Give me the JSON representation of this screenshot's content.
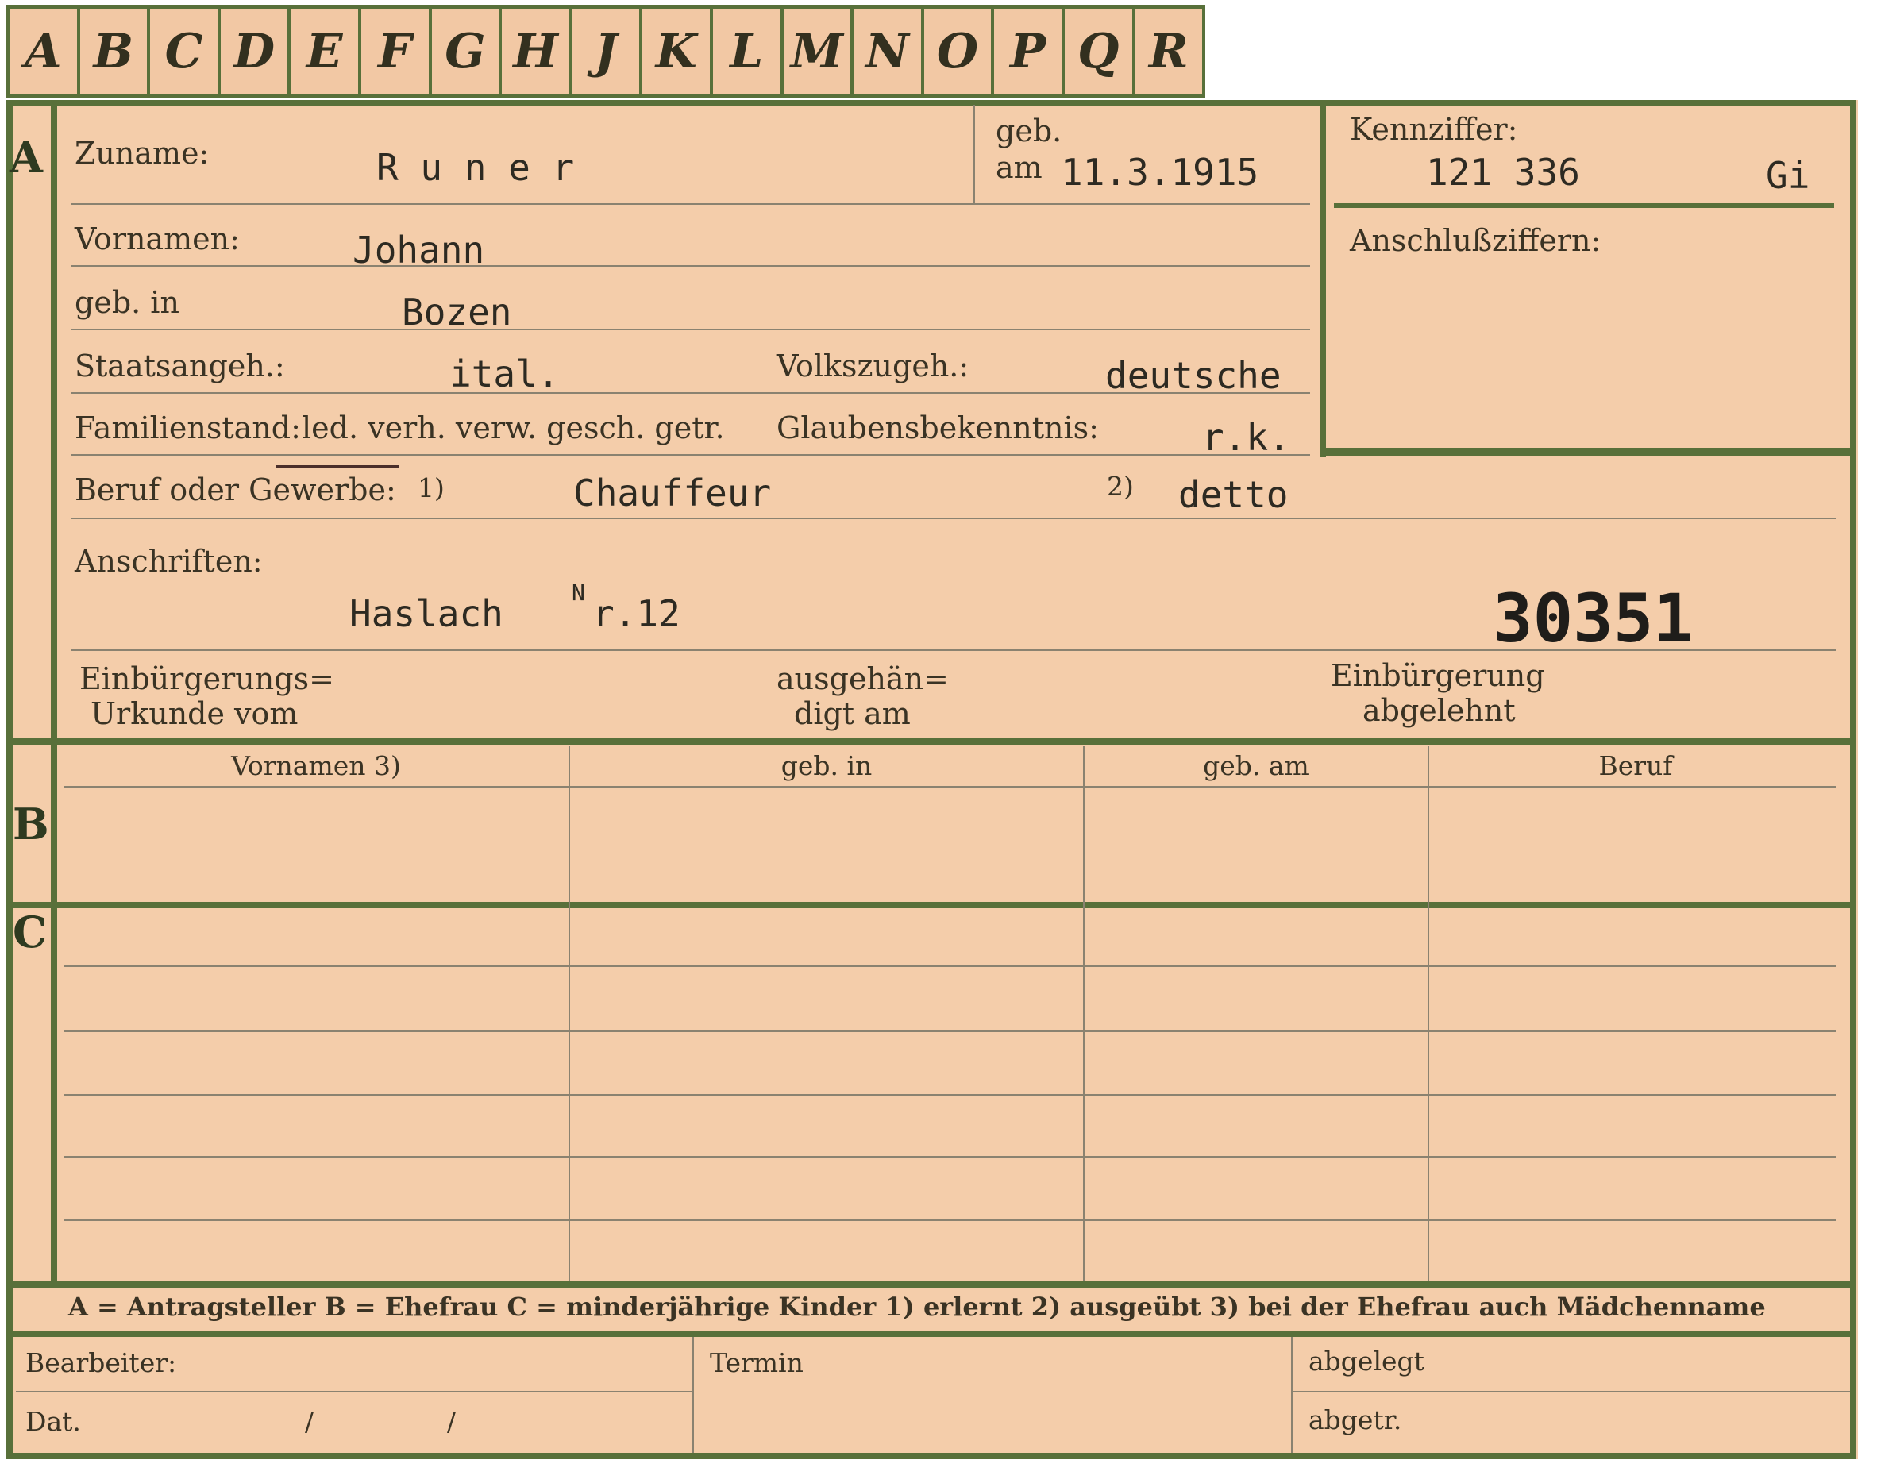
{
  "tabs": [
    "A",
    "B",
    "C",
    "D",
    "E",
    "F",
    "G",
    "H",
    "J",
    "K",
    "L",
    "M",
    "N",
    "O",
    "P",
    "Q",
    "R"
  ],
  "rows": {
    "a": "A",
    "b": "B",
    "c": "C"
  },
  "section_a": {
    "surname_label": "Zuname:",
    "surname": "R u n e r",
    "born_label_1": "geb.",
    "born_label_2": "am",
    "born_date": "11.3.1915",
    "id_label": "Kennziffer:",
    "id_number": "121 336",
    "id_suffix": "Gi",
    "linked_label": "Anschlußziffern:",
    "firstnames_label": "Vornamen:",
    "firstnames": "Johann",
    "birthplace_label": "geb. in",
    "birthplace": "Bozen",
    "citizenship_label": "Staatsangeh.:",
    "citizenship": "ital.",
    "ethnicity_label": "Volkszugeh.:",
    "ethnicity": "deutsche",
    "marital_label": "Familienstand:",
    "marital_options": "led. verh. verw. gesch. getr.",
    "religion_label": "Glaubensbekenntnis:",
    "religion": "r.k.",
    "occupation_label": "Beruf oder Gewerbe:",
    "occupation_mark_1": "1)",
    "occupation": "Chauffeur",
    "occupation_mark_2": "2)",
    "occupation_2": "detto",
    "address_label": "Anschriften:",
    "address": "Haslach",
    "address_nr_sup": "N",
    "address_nr": "r.12",
    "file_number": "30351",
    "naturalization_label_1": "Einbürgerungs=",
    "naturalization_label_2": "Urkunde vom",
    "handed_label_1": "ausgehän=",
    "handed_label_2": "digt am",
    "refused_label_1": "Einbürgerung",
    "refused_label_2": "abgelehnt"
  },
  "section_b": {
    "col_firstnames": "Vornamen 3)",
    "col_birthplace": "geb. in",
    "col_birthdate": "geb. am",
    "col_occupation": "Beruf"
  },
  "legend": "A = Antragsteller   B = Ehefrau   C = minderjährige Kinder   1) erlernt   2) ausgeübt   3) bei der Ehefrau auch Mädchenname",
  "footer": {
    "clerk_label": "Bearbeiter:",
    "date_label": "Dat.",
    "date_sep": "/                /",
    "deadline_label": "Termin",
    "filed_label": "abgelegt",
    "delivered_label": "abgetr."
  }
}
